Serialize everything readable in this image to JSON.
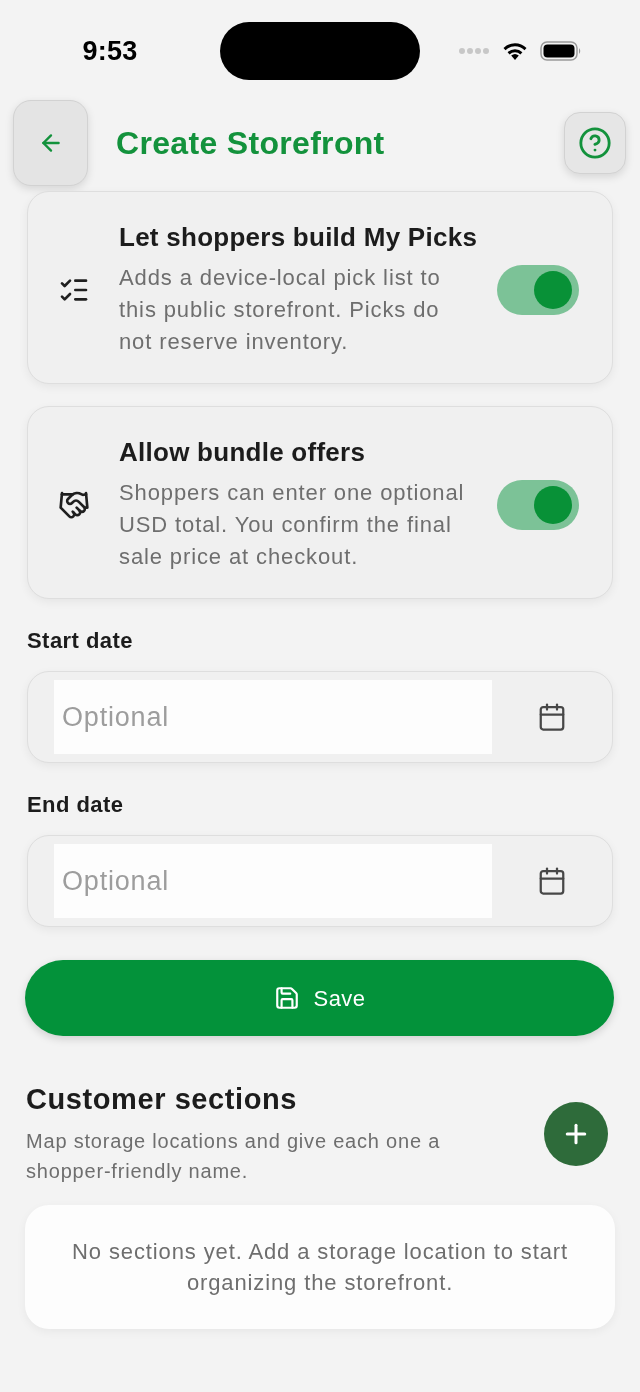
{
  "status_bar": {
    "time": "9:53"
  },
  "header": {
    "title": "Create Storefront"
  },
  "settings": [
    {
      "kind": "list",
      "title": "Let shoppers build My Picks",
      "description": "Adds a device-local pick list to this public storefront. Picks do not reserve inventory.",
      "on": true
    },
    {
      "kind": "offer",
      "title": "Allow bundle offers",
      "description": "Shoppers can enter one optional USD total. You confirm the final sale price at checkout.",
      "on": true
    }
  ],
  "date_fields": [
    {
      "label": "Start date",
      "placeholder": "Optional"
    },
    {
      "label": "End date",
      "placeholder": "Optional"
    }
  ],
  "save_button": {
    "label": "Save"
  },
  "customer_sections": {
    "title": "Customer sections",
    "description": "Map storage locations and give each one a shopper-friendly name.",
    "empty_message": "No sections yet. Add a storage location to start organizing the storefront."
  }
}
